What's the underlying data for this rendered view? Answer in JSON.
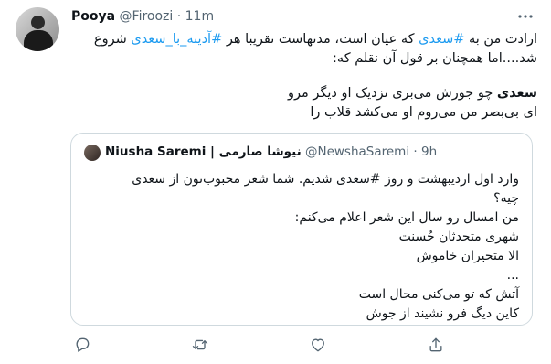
{
  "tweet": {
    "author_name": "Pooya",
    "author_handle": "@Firoozi",
    "separator": "·",
    "time": "11m",
    "more_icon": "more-icon",
    "line1": "ارادت من به #سعدی که عیان است، مدتهاست تقریبا هر #آدینه_با_سعدی شروع",
    "line2": "شد....اما همچنان بر قول آن نقلم که:",
    "line3": "سعدی چو جورش می‌بری نزدیک او دیگر مرو",
    "line4": "ای بی‌بصر من می‌روم او می‌کشد قلاب را"
  },
  "quote": {
    "author_name": "Niusha Saremi | نیوشا صارمی",
    "author_handle": "@NewshaSaremi",
    "separator": "·",
    "time": "9h",
    "lines": [
      "وارد اول اردیبهشت و روز #سعدی شدیم. شما شعر محبوب‌تون از سعدی",
      "چیه؟",
      "من امسال رو سال این شعر  اعلام می‌کنم:",
      "شهری متحدثان حُسنت",
      "الا متحیران خاموش",
      "...",
      "آتش که تو می‌کنی محال است",
      "کاین دیگ فرو نشیند از جوش"
    ]
  },
  "actions": {
    "reply_icon": "reply-icon",
    "retweet_icon": "retweet-icon",
    "like_icon": "like-icon",
    "share_icon": "share-icon"
  },
  "colors": {
    "accent": "#1d9bf0",
    "text": "#0f1419",
    "muted": "#536471",
    "border": "#cfd9de"
  }
}
